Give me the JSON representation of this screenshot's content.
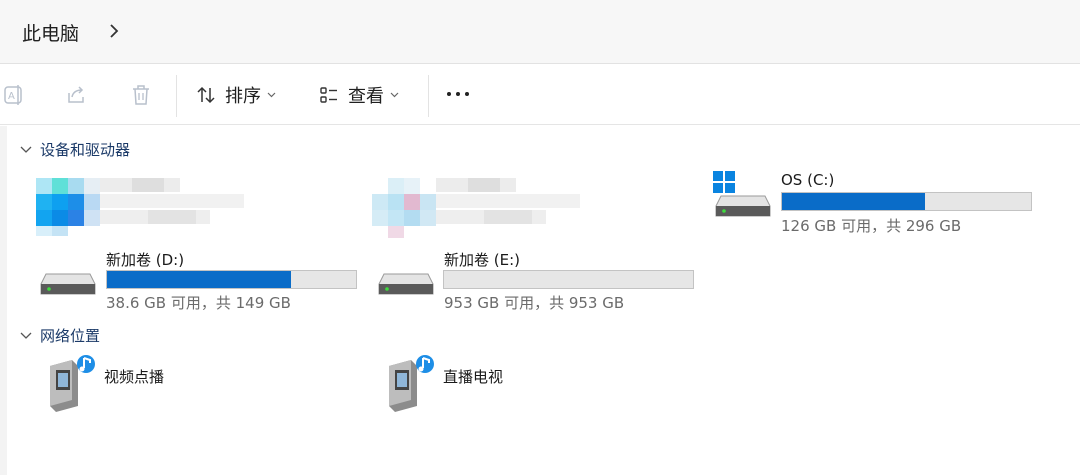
{
  "address": {
    "crumb": "此电脑"
  },
  "toolbar": {
    "sort_label": "排序",
    "view_label": "查看"
  },
  "sections": {
    "devices": {
      "title": "设备和驱动器"
    },
    "network": {
      "title": "网络位置"
    }
  },
  "drives": [
    {
      "key": "c",
      "name": "OS (C:)",
      "capacity": "126 GB 可用，共 296 GB",
      "used_fraction": 0.574
    },
    {
      "key": "d",
      "name": "新加卷 (D:)",
      "capacity": "38.6 GB 可用，共 149 GB",
      "used_fraction": 0.74
    },
    {
      "key": "e",
      "name": "新加卷 (E:)",
      "capacity": "953 GB 可用，共 953 GB",
      "used_fraction": 0.0
    }
  ],
  "network_locations": [
    {
      "name": "视频点播"
    },
    {
      "name": "直播电视"
    }
  ],
  "colors": {
    "accent": "#0a6cc8",
    "bar_bg": "#e6e6e6",
    "section_text": "#1b3a68"
  }
}
